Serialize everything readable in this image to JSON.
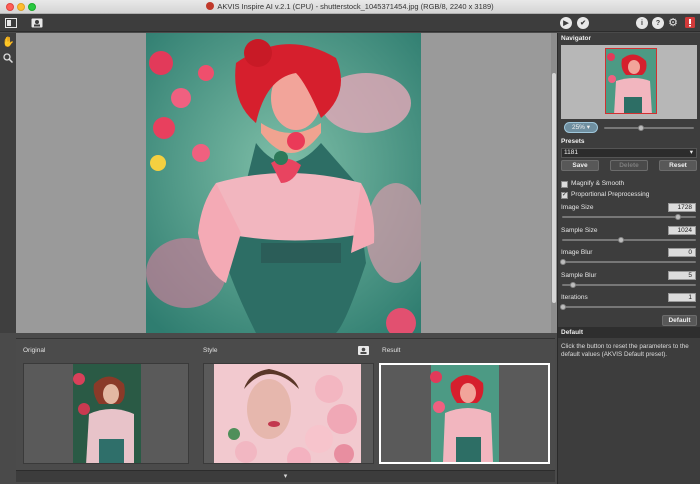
{
  "window": {
    "title": "AKVIS Inspire AI v.2.1 (CPU) - shutterstock_1045371454.jpg (RGB/8, 2240 x 3189)"
  },
  "toolbar": {
    "run_icon": "play-icon",
    "apply_icon": "check-icon",
    "info_icon": "info-icon",
    "help_icon": "help-icon",
    "settings_icon": "gear-icon",
    "notify_icon": "notification-icon"
  },
  "thumbs": {
    "original_label": "Original",
    "style_label": "Style",
    "result_label": "Result"
  },
  "navigator": {
    "header": "Navigator",
    "zoom": "25%",
    "zoom_slider_level": 0.4
  },
  "presets": {
    "header": "Presets",
    "selected": "1181",
    "save": "Save",
    "delete": "Delete",
    "reset": "Reset"
  },
  "options": {
    "magnify": {
      "label": "Magnify & Smooth",
      "checked": false
    },
    "proportional": {
      "label": "Proportional Preprocessing",
      "checked": true
    }
  },
  "params": [
    {
      "label": "Image Size",
      "value": "1728",
      "level": 0.9
    },
    {
      "label": "Sample Size",
      "value": "1024",
      "level": 0.45
    },
    {
      "label": "Image Blur",
      "value": "0",
      "level": 0.0
    },
    {
      "label": "Sample Blur",
      "value": "5",
      "level": 0.08
    },
    {
      "label": "Iterations",
      "value": "1",
      "level": 0.0
    }
  ],
  "default_button": "Default",
  "help": {
    "header": "Default",
    "text": "Click the button to reset the parameters to the default values (AKVIS Default preset)."
  },
  "colors": {
    "accent": "#6f8fa0",
    "canvas_bg": "#9a9a9a",
    "panel_bg": "#3d3d3d"
  }
}
